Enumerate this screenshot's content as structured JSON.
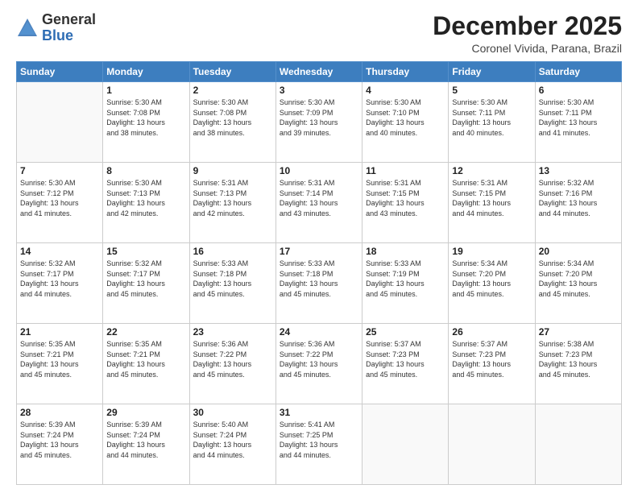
{
  "logo": {
    "general": "General",
    "blue": "Blue"
  },
  "header": {
    "month": "December 2025",
    "location": "Coronel Vivida, Parana, Brazil"
  },
  "days_of_week": [
    "Sunday",
    "Monday",
    "Tuesday",
    "Wednesday",
    "Thursday",
    "Friday",
    "Saturday"
  ],
  "weeks": [
    [
      {
        "day": "",
        "info": ""
      },
      {
        "day": "1",
        "info": "Sunrise: 5:30 AM\nSunset: 7:08 PM\nDaylight: 13 hours\nand 38 minutes."
      },
      {
        "day": "2",
        "info": "Sunrise: 5:30 AM\nSunset: 7:08 PM\nDaylight: 13 hours\nand 38 minutes."
      },
      {
        "day": "3",
        "info": "Sunrise: 5:30 AM\nSunset: 7:09 PM\nDaylight: 13 hours\nand 39 minutes."
      },
      {
        "day": "4",
        "info": "Sunrise: 5:30 AM\nSunset: 7:10 PM\nDaylight: 13 hours\nand 40 minutes."
      },
      {
        "day": "5",
        "info": "Sunrise: 5:30 AM\nSunset: 7:11 PM\nDaylight: 13 hours\nand 40 minutes."
      },
      {
        "day": "6",
        "info": "Sunrise: 5:30 AM\nSunset: 7:11 PM\nDaylight: 13 hours\nand 41 minutes."
      }
    ],
    [
      {
        "day": "7",
        "info": "Sunrise: 5:30 AM\nSunset: 7:12 PM\nDaylight: 13 hours\nand 41 minutes."
      },
      {
        "day": "8",
        "info": "Sunrise: 5:30 AM\nSunset: 7:13 PM\nDaylight: 13 hours\nand 42 minutes."
      },
      {
        "day": "9",
        "info": "Sunrise: 5:31 AM\nSunset: 7:13 PM\nDaylight: 13 hours\nand 42 minutes."
      },
      {
        "day": "10",
        "info": "Sunrise: 5:31 AM\nSunset: 7:14 PM\nDaylight: 13 hours\nand 43 minutes."
      },
      {
        "day": "11",
        "info": "Sunrise: 5:31 AM\nSunset: 7:15 PM\nDaylight: 13 hours\nand 43 minutes."
      },
      {
        "day": "12",
        "info": "Sunrise: 5:31 AM\nSunset: 7:15 PM\nDaylight: 13 hours\nand 44 minutes."
      },
      {
        "day": "13",
        "info": "Sunrise: 5:32 AM\nSunset: 7:16 PM\nDaylight: 13 hours\nand 44 minutes."
      }
    ],
    [
      {
        "day": "14",
        "info": "Sunrise: 5:32 AM\nSunset: 7:17 PM\nDaylight: 13 hours\nand 44 minutes."
      },
      {
        "day": "15",
        "info": "Sunrise: 5:32 AM\nSunset: 7:17 PM\nDaylight: 13 hours\nand 45 minutes."
      },
      {
        "day": "16",
        "info": "Sunrise: 5:33 AM\nSunset: 7:18 PM\nDaylight: 13 hours\nand 45 minutes."
      },
      {
        "day": "17",
        "info": "Sunrise: 5:33 AM\nSunset: 7:18 PM\nDaylight: 13 hours\nand 45 minutes."
      },
      {
        "day": "18",
        "info": "Sunrise: 5:33 AM\nSunset: 7:19 PM\nDaylight: 13 hours\nand 45 minutes."
      },
      {
        "day": "19",
        "info": "Sunrise: 5:34 AM\nSunset: 7:20 PM\nDaylight: 13 hours\nand 45 minutes."
      },
      {
        "day": "20",
        "info": "Sunrise: 5:34 AM\nSunset: 7:20 PM\nDaylight: 13 hours\nand 45 minutes."
      }
    ],
    [
      {
        "day": "21",
        "info": "Sunrise: 5:35 AM\nSunset: 7:21 PM\nDaylight: 13 hours\nand 45 minutes."
      },
      {
        "day": "22",
        "info": "Sunrise: 5:35 AM\nSunset: 7:21 PM\nDaylight: 13 hours\nand 45 minutes."
      },
      {
        "day": "23",
        "info": "Sunrise: 5:36 AM\nSunset: 7:22 PM\nDaylight: 13 hours\nand 45 minutes."
      },
      {
        "day": "24",
        "info": "Sunrise: 5:36 AM\nSunset: 7:22 PM\nDaylight: 13 hours\nand 45 minutes."
      },
      {
        "day": "25",
        "info": "Sunrise: 5:37 AM\nSunset: 7:23 PM\nDaylight: 13 hours\nand 45 minutes."
      },
      {
        "day": "26",
        "info": "Sunrise: 5:37 AM\nSunset: 7:23 PM\nDaylight: 13 hours\nand 45 minutes."
      },
      {
        "day": "27",
        "info": "Sunrise: 5:38 AM\nSunset: 7:23 PM\nDaylight: 13 hours\nand 45 minutes."
      }
    ],
    [
      {
        "day": "28",
        "info": "Sunrise: 5:39 AM\nSunset: 7:24 PM\nDaylight: 13 hours\nand 45 minutes."
      },
      {
        "day": "29",
        "info": "Sunrise: 5:39 AM\nSunset: 7:24 PM\nDaylight: 13 hours\nand 44 minutes."
      },
      {
        "day": "30",
        "info": "Sunrise: 5:40 AM\nSunset: 7:24 PM\nDaylight: 13 hours\nand 44 minutes."
      },
      {
        "day": "31",
        "info": "Sunrise: 5:41 AM\nSunset: 7:25 PM\nDaylight: 13 hours\nand 44 minutes."
      },
      {
        "day": "",
        "info": ""
      },
      {
        "day": "",
        "info": ""
      },
      {
        "day": "",
        "info": ""
      }
    ]
  ]
}
